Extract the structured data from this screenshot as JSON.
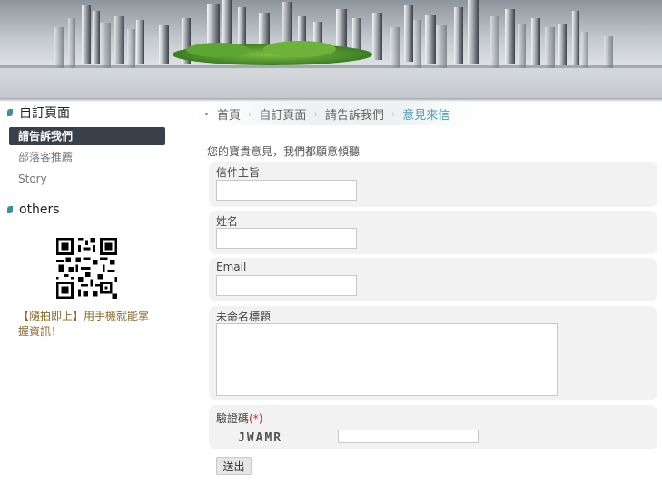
{
  "banner": {
    "description_icon": "city-skyline-banner"
  },
  "sidebar": {
    "section1_title": "自訂頁面",
    "items": [
      {
        "label": "請告訴我們",
        "active": true
      },
      {
        "label": "部落客推薦",
        "active": false
      },
      {
        "label": "Story",
        "active": false
      }
    ],
    "section2_title": "others",
    "qr_icon": "qr-code-icon",
    "promo_text": "【隨拍即上】用手機就能掌握資訊！"
  },
  "breadcrumb": {
    "items": [
      "首頁",
      "自訂頁面",
      "請告訴我們",
      "意見來信"
    ],
    "separator_icon": "chevron-right-icon"
  },
  "form": {
    "intro": "您的寶貴意見，我們都願意傾聽",
    "fields": [
      {
        "label": "信件主旨",
        "value": "",
        "placeholder": ""
      },
      {
        "label": "姓名",
        "value": "",
        "placeholder": ""
      },
      {
        "label": "Email",
        "value": "",
        "placeholder": ""
      },
      {
        "label": "未命名標題",
        "value": "",
        "placeholder": ""
      }
    ],
    "captcha_label": "驗證碼",
    "required_mark": "(*)",
    "captcha_text": "JWAMR",
    "captcha_value": "",
    "submit_label": "送出"
  },
  "colors": {
    "accent": "#4b9eb7",
    "active_nav_bg": "#39404a",
    "promo_text": "#8b6a2c",
    "required": "#dd2222"
  }
}
